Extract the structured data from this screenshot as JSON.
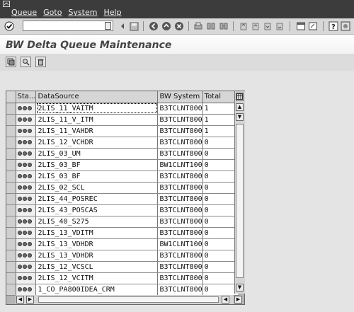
{
  "menu": {
    "items": [
      "Queue",
      "Goto",
      "System",
      "Help"
    ]
  },
  "toolbar": {
    "command_value": "",
    "icons": [
      "enter-icon",
      "save-icon",
      "back-icon",
      "exit-icon",
      "cancel-icon",
      "print-icon",
      "find-icon",
      "find-next-icon",
      "first-page-icon",
      "previous-page-icon",
      "next-page-icon",
      "last-page-icon",
      "create-session-icon",
      "shortcut-icon",
      "help-icon",
      "customize-layout-icon"
    ]
  },
  "title": "BW Delta Queue Maintenance",
  "app_toolbar": {
    "buttons": [
      "refresh-icon",
      "display-icon",
      "delete-icon"
    ]
  },
  "table": {
    "headers": {
      "status": "Sta...",
      "datasource": "DataSource",
      "bw_system": "BW System",
      "total": "Total"
    },
    "rows": [
      {
        "datasource": "2LIS_11_VAITM",
        "bw_system": "B3TCLNT800",
        "total": "1"
      },
      {
        "datasource": "2LIS_11_V_ITM",
        "bw_system": "B3TCLNT800",
        "total": "1"
      },
      {
        "datasource": "2LIS_11_VAHDR",
        "bw_system": "B3TCLNT800",
        "total": "1"
      },
      {
        "datasource": "2LIS_12_VCHDR",
        "bw_system": "B3TCLNT800",
        "total": "0"
      },
      {
        "datasource": "2LIS_03_UM",
        "bw_system": "B3TCLNT800",
        "total": "0"
      },
      {
        "datasource": "2LIS_03_BF",
        "bw_system": "BW1CLNT100",
        "total": "0"
      },
      {
        "datasource": "2LIS_03_BF",
        "bw_system": "B3TCLNT800",
        "total": "0"
      },
      {
        "datasource": "2LIS_02_SCL",
        "bw_system": "B3TCLNT800",
        "total": "0"
      },
      {
        "datasource": "2LIS_44_POSREC",
        "bw_system": "B3TCLNT800",
        "total": "0"
      },
      {
        "datasource": "2LIS_43_POSCAS",
        "bw_system": "B3TCLNT800",
        "total": "0"
      },
      {
        "datasource": "2LIS_40_S275",
        "bw_system": "B3TCLNT800",
        "total": "0"
      },
      {
        "datasource": "2LIS_13_VDITM",
        "bw_system": "B3TCLNT800",
        "total": "0"
      },
      {
        "datasource": "2LIS_13_VDHDR",
        "bw_system": "BW1CLNT100",
        "total": "0"
      },
      {
        "datasource": "2LIS_13_VDHDR",
        "bw_system": "B3TCLNT800",
        "total": "0"
      },
      {
        "datasource": "2LIS_12_VCSCL",
        "bw_system": "B3TCLNT800",
        "total": "0"
      },
      {
        "datasource": "2LIS_12_VCITM",
        "bw_system": "B3TCLNT800",
        "total": "0"
      },
      {
        "datasource": "1_CO_PA800IDEA_CRM",
        "bw_system": "B3TCLNT800",
        "total": "0"
      }
    ]
  },
  "colors": {
    "menubar": "#3c3c3c",
    "title_text": "#444444",
    "grid_bg": "#b4b4b4"
  }
}
